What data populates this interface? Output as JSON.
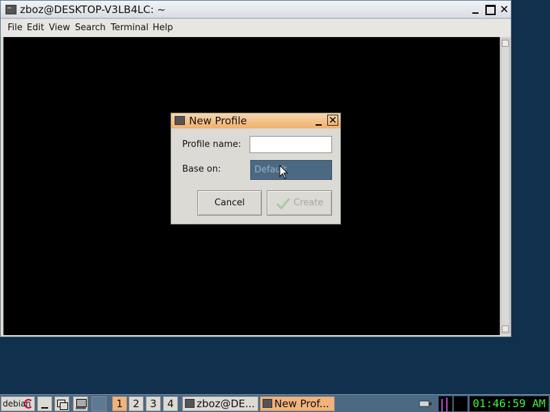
{
  "terminal": {
    "title": "zboz@DESKTOP-V3LB4LC: ~",
    "menu": [
      "File",
      "Edit",
      "View",
      "Search",
      "Terminal",
      "Help"
    ]
  },
  "dialog": {
    "title": "New Profile",
    "profile_name_label": "Profile name:",
    "profile_name_value": "",
    "base_on_label": "Base on:",
    "base_on_value": "Default",
    "cancel_label": "Cancel",
    "create_label": "Create"
  },
  "taskbar": {
    "logo_text": "debian",
    "workspaces": [
      "1",
      "2",
      "3",
      "4"
    ],
    "active_workspace": "1",
    "tasks": [
      {
        "label": "zboz@DE..."
      },
      {
        "label": "New Prof..."
      }
    ],
    "clock": "01:46:59 AM"
  },
  "colors": {
    "desktop": "#11304e",
    "dialog_titlebar": "#f1b16c",
    "selection": "#4b6983",
    "clock_text": "#3ef43e"
  }
}
